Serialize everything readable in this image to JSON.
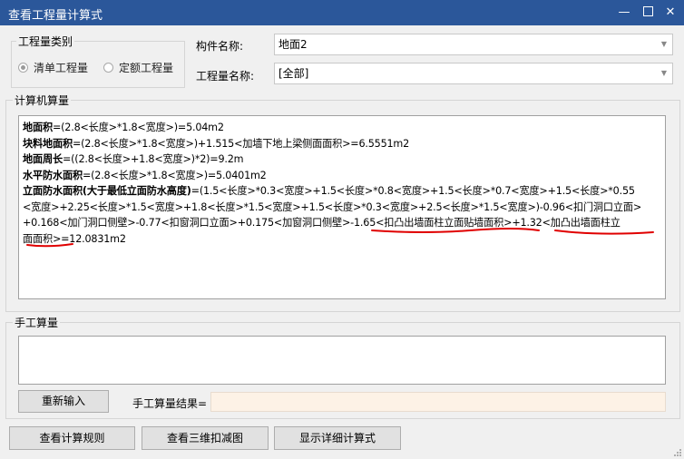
{
  "window": {
    "title": "查看工程量计算式",
    "minimize": "—",
    "close": "✕"
  },
  "category": {
    "legend": "工程量类别",
    "options": [
      {
        "label": "清单工程量",
        "selected": true
      },
      {
        "label": "定额工程量",
        "selected": false
      }
    ]
  },
  "component": {
    "label": "构件名称:",
    "value": "地面2"
  },
  "quantity": {
    "label": "工程量名称:",
    "value": "[全部]"
  },
  "computer": {
    "legend": "计算机算量",
    "lines": [
      {
        "name": "地面积",
        "formula": "=(2.8<长度>*1.8<宽度>)=5.04m2"
      },
      {
        "name": "块料地面积",
        "formula": "=(2.8<长度>*1.8<宽度>)+1.515<加墙下地上梁侧面面积>=6.5551m2"
      },
      {
        "name": "地面周长",
        "formula": "=((2.8<长度>+1.8<宽度>)*2)=9.2m"
      },
      {
        "name": "水平防水面积",
        "formula": "=(2.8<长度>*1.8<宽度>)=5.0401m2"
      }
    ],
    "vertical_name": "立面防水面积(大于最低立面防水高度)",
    "vertical_row1": "=(1.5<长度>*0.3<宽度>+1.5<长度>*0.8<宽度>+1.5<长度>*0.7<宽度>+1.5<长度>*0.55",
    "vertical_row2": "<宽度>+2.25<长度>*1.5<宽度>+1.8<长度>*1.5<宽度>+1.5<长度>*0.3<宽度>+2.5<长度>*1.5<宽度>)-0.96<扣门洞口立面>",
    "vertical_row3": "+0.168<加门洞口侧壁>-0.77<扣窗洞口立面>+0.175<加窗洞口侧壁>-1.65<扣凸出墙面柱立面贴墙面积>+1.32<加凸出墙面柱立",
    "vertical_row4": "面面积>=12.0831m2"
  },
  "manual": {
    "legend": "手工算量",
    "value": "",
    "reinput_button": "重新输入",
    "result_label": "手工算量结果=",
    "result_value": ""
  },
  "footer": {
    "rules_button": "查看计算规则",
    "view3d_button": "查看三维扣减图",
    "detail_button": "显示详细计算式"
  },
  "colors": {
    "titlebar": "#2b579a",
    "annotation": "#e00000",
    "result_bg": "#fdf2e6"
  },
  "icons": [
    "minimize-icon",
    "maximize-icon",
    "close-icon",
    "dropdown-arrow-icon",
    "resize-grip-icon"
  ]
}
